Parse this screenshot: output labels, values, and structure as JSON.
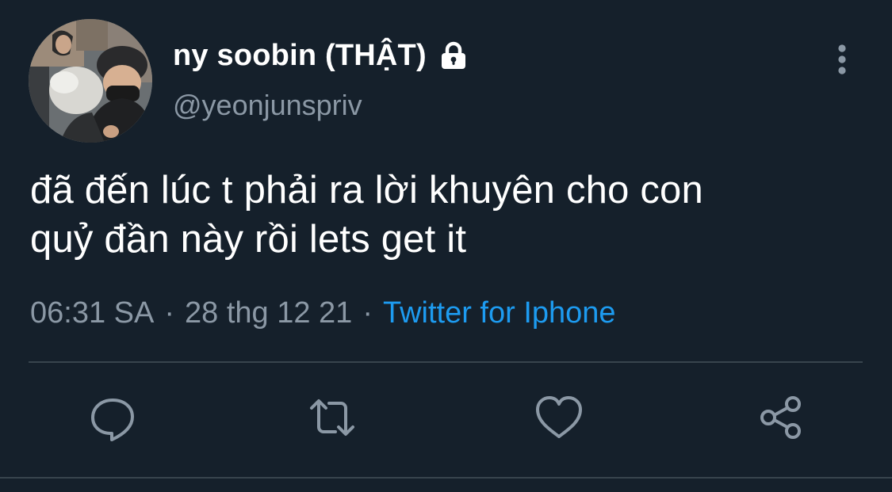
{
  "user": {
    "display_name": "ny soobin (THẬT)",
    "handle": "@yeonjunspriv",
    "protected_icon": "lock-icon"
  },
  "tweet": {
    "text_line1": "đã đến lúc t phải ra lời khuyên cho con",
    "text_line2": "quỷ đần này rồi lets get it"
  },
  "meta": {
    "time": "06:31 SA",
    "separator": "·",
    "date": "28 thg 12 21",
    "source": "Twitter for Iphone"
  },
  "actions": {
    "reply_icon": "reply-icon",
    "retweet_icon": "retweet-icon",
    "like_icon": "heart-icon",
    "share_icon": "share-icon"
  },
  "colors": {
    "background": "#15202b",
    "text_primary": "#ffffff",
    "text_secondary": "#8b98a5",
    "accent": "#1d9bf0",
    "divider": "#38444d"
  }
}
